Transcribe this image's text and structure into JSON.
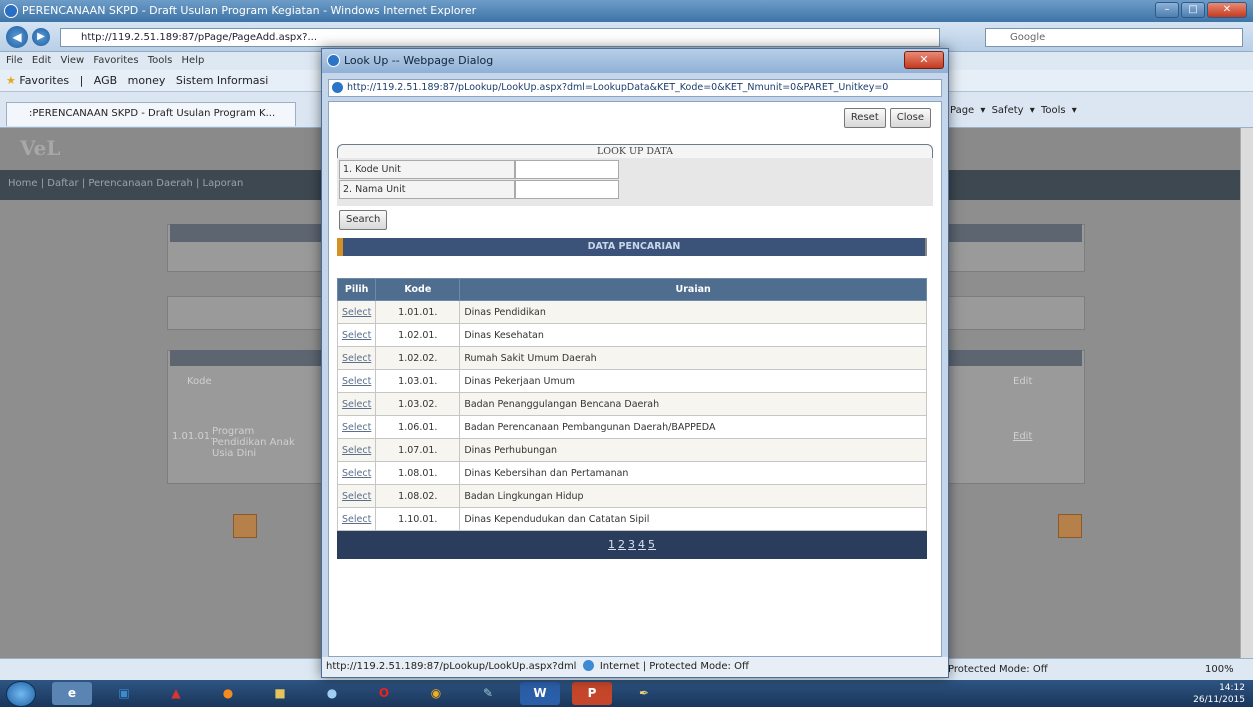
{
  "ie": {
    "title": "PERENCANAAN SKPD - Draft Usulan Program Kegiatan - Windows Internet Explorer",
    "address": "http://119.2.51.189:87/pPage/PageAdd.aspx?...",
    "search_placeholder": "Google",
    "menu": "File  Edit  View  Favorites  Tools  Help",
    "favorites_label": "Favorites",
    "fav_links": [
      "AGB",
      "money",
      "Sistem Informasi"
    ],
    "tab_title": ":PERENCANAAN SKPD - Draft Usulan Program K...",
    "command_bar": "Page ▾  Safety ▾  Tools ▾",
    "status_zone": "Protected Mode: Off",
    "zoom": "100%",
    "win_min": "–",
    "win_max": "□",
    "win_close": "✕"
  },
  "background_page": {
    "nav_text": "Home | Daftar | Perencanaan Daerah | Laporan",
    "label_kode": "Kode",
    "label_row_kode": "1.01.01.",
    "label_row_program": "Program Pendidikan Anak Usia Dini",
    "label_edit": "Edit",
    "label_edit_link": "Edit"
  },
  "dialog": {
    "title": "Look Up -- Webpage Dialog",
    "close_label": "✕",
    "url": "http://119.2.51.189:87/pLookup/LookUp.aspx?dml=LookupData&KET_Kode=0&KET_Nmunit=0&PARET_Unitkey=0",
    "reset_label": "Reset",
    "close_button_label": "Close",
    "lookup_header": "LOOK UP DATA",
    "field1_label": "1. Kode Unit",
    "field2_label": "2. Nama Unit",
    "search_label": "Search",
    "result_header": "DATA PENCARIAN",
    "columns": {
      "pilih": "Pilih",
      "kode": "Kode",
      "uraian": "Uraian"
    },
    "select_label": "Select",
    "rows": [
      {
        "kode": "1.01.01.",
        "uraian": "Dinas Pendidikan"
      },
      {
        "kode": "1.02.01.",
        "uraian": "Dinas Kesehatan"
      },
      {
        "kode": "1.02.02.",
        "uraian": "Rumah Sakit Umum Daerah"
      },
      {
        "kode": "1.03.01.",
        "uraian": "Dinas Pekerjaan Umum"
      },
      {
        "kode": "1.03.02.",
        "uraian": "Badan Penanggulangan Bencana Daerah"
      },
      {
        "kode": "1.06.01.",
        "uraian": "Badan Perencanaan Pembangunan Daerah/BAPPEDA"
      },
      {
        "kode": "1.07.01.",
        "uraian": "Dinas Perhubungan"
      },
      {
        "kode": "1.08.01.",
        "uraian": "Dinas Kebersihan dan Pertamanan"
      },
      {
        "kode": "1.08.02.",
        "uraian": "Badan Lingkungan Hidup"
      },
      {
        "kode": "1.10.01.",
        "uraian": "Dinas Kependudukan dan Catatan Sipil"
      }
    ],
    "pages": [
      "1",
      "2",
      "3",
      "4",
      "5"
    ],
    "status": "http://119.2.51.189:87/pLookup/LookUp.aspx?dml",
    "status_zone": "Internet | Protected Mode: Off"
  },
  "taskbar": {
    "apps": [
      "IE",
      "Explorer",
      "PDF",
      "Firefox",
      "Folder",
      "Chrome",
      "Opera",
      "Chrome",
      "Tools",
      "Word",
      "PowerPoint",
      "Pen"
    ],
    "app_letters": {
      "word": "W",
      "ppt": "P"
    },
    "clock_time": "14:12",
    "clock_date": "26/11/2015"
  },
  "colors": {
    "result_header_bg": "#3b5379",
    "table_header_bg": "#4f6d8f",
    "pager_bg": "#2a3d5c",
    "accent_orange": "#d39025"
  }
}
